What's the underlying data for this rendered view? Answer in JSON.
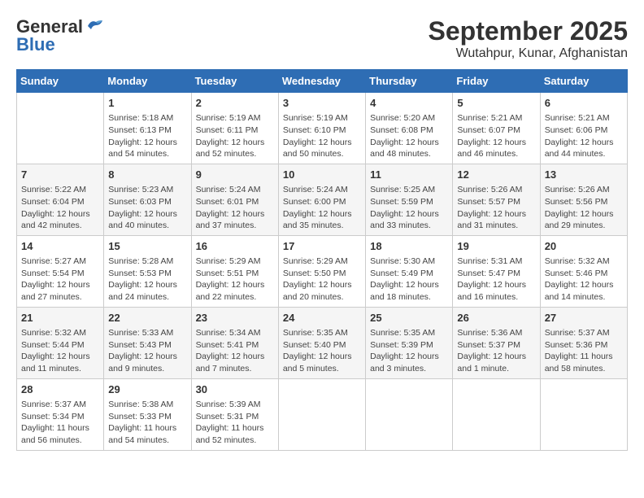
{
  "logo": {
    "line1": "General",
    "line2": "Blue"
  },
  "title": "September 2025",
  "subtitle": "Wutahpur, Kunar, Afghanistan",
  "headers": [
    "Sunday",
    "Monday",
    "Tuesday",
    "Wednesday",
    "Thursday",
    "Friday",
    "Saturday"
  ],
  "weeks": [
    [
      {
        "day": "",
        "content": ""
      },
      {
        "day": "1",
        "content": "Sunrise: 5:18 AM\nSunset: 6:13 PM\nDaylight: 12 hours\nand 54 minutes."
      },
      {
        "day": "2",
        "content": "Sunrise: 5:19 AM\nSunset: 6:11 PM\nDaylight: 12 hours\nand 52 minutes."
      },
      {
        "day": "3",
        "content": "Sunrise: 5:19 AM\nSunset: 6:10 PM\nDaylight: 12 hours\nand 50 minutes."
      },
      {
        "day": "4",
        "content": "Sunrise: 5:20 AM\nSunset: 6:08 PM\nDaylight: 12 hours\nand 48 minutes."
      },
      {
        "day": "5",
        "content": "Sunrise: 5:21 AM\nSunset: 6:07 PM\nDaylight: 12 hours\nand 46 minutes."
      },
      {
        "day": "6",
        "content": "Sunrise: 5:21 AM\nSunset: 6:06 PM\nDaylight: 12 hours\nand 44 minutes."
      }
    ],
    [
      {
        "day": "7",
        "content": "Sunrise: 5:22 AM\nSunset: 6:04 PM\nDaylight: 12 hours\nand 42 minutes."
      },
      {
        "day": "8",
        "content": "Sunrise: 5:23 AM\nSunset: 6:03 PM\nDaylight: 12 hours\nand 40 minutes."
      },
      {
        "day": "9",
        "content": "Sunrise: 5:24 AM\nSunset: 6:01 PM\nDaylight: 12 hours\nand 37 minutes."
      },
      {
        "day": "10",
        "content": "Sunrise: 5:24 AM\nSunset: 6:00 PM\nDaylight: 12 hours\nand 35 minutes."
      },
      {
        "day": "11",
        "content": "Sunrise: 5:25 AM\nSunset: 5:59 PM\nDaylight: 12 hours\nand 33 minutes."
      },
      {
        "day": "12",
        "content": "Sunrise: 5:26 AM\nSunset: 5:57 PM\nDaylight: 12 hours\nand 31 minutes."
      },
      {
        "day": "13",
        "content": "Sunrise: 5:26 AM\nSunset: 5:56 PM\nDaylight: 12 hours\nand 29 minutes."
      }
    ],
    [
      {
        "day": "14",
        "content": "Sunrise: 5:27 AM\nSunset: 5:54 PM\nDaylight: 12 hours\nand 27 minutes."
      },
      {
        "day": "15",
        "content": "Sunrise: 5:28 AM\nSunset: 5:53 PM\nDaylight: 12 hours\nand 24 minutes."
      },
      {
        "day": "16",
        "content": "Sunrise: 5:29 AM\nSunset: 5:51 PM\nDaylight: 12 hours\nand 22 minutes."
      },
      {
        "day": "17",
        "content": "Sunrise: 5:29 AM\nSunset: 5:50 PM\nDaylight: 12 hours\nand 20 minutes."
      },
      {
        "day": "18",
        "content": "Sunrise: 5:30 AM\nSunset: 5:49 PM\nDaylight: 12 hours\nand 18 minutes."
      },
      {
        "day": "19",
        "content": "Sunrise: 5:31 AM\nSunset: 5:47 PM\nDaylight: 12 hours\nand 16 minutes."
      },
      {
        "day": "20",
        "content": "Sunrise: 5:32 AM\nSunset: 5:46 PM\nDaylight: 12 hours\nand 14 minutes."
      }
    ],
    [
      {
        "day": "21",
        "content": "Sunrise: 5:32 AM\nSunset: 5:44 PM\nDaylight: 12 hours\nand 11 minutes."
      },
      {
        "day": "22",
        "content": "Sunrise: 5:33 AM\nSunset: 5:43 PM\nDaylight: 12 hours\nand 9 minutes."
      },
      {
        "day": "23",
        "content": "Sunrise: 5:34 AM\nSunset: 5:41 PM\nDaylight: 12 hours\nand 7 minutes."
      },
      {
        "day": "24",
        "content": "Sunrise: 5:35 AM\nSunset: 5:40 PM\nDaylight: 12 hours\nand 5 minutes."
      },
      {
        "day": "25",
        "content": "Sunrise: 5:35 AM\nSunset: 5:39 PM\nDaylight: 12 hours\nand 3 minutes."
      },
      {
        "day": "26",
        "content": "Sunrise: 5:36 AM\nSunset: 5:37 PM\nDaylight: 12 hours\nand 1 minute."
      },
      {
        "day": "27",
        "content": "Sunrise: 5:37 AM\nSunset: 5:36 PM\nDaylight: 11 hours\nand 58 minutes."
      }
    ],
    [
      {
        "day": "28",
        "content": "Sunrise: 5:37 AM\nSunset: 5:34 PM\nDaylight: 11 hours\nand 56 minutes."
      },
      {
        "day": "29",
        "content": "Sunrise: 5:38 AM\nSunset: 5:33 PM\nDaylight: 11 hours\nand 54 minutes."
      },
      {
        "day": "30",
        "content": "Sunrise: 5:39 AM\nSunset: 5:31 PM\nDaylight: 11 hours\nand 52 minutes."
      },
      {
        "day": "",
        "content": ""
      },
      {
        "day": "",
        "content": ""
      },
      {
        "day": "",
        "content": ""
      },
      {
        "day": "",
        "content": ""
      }
    ]
  ]
}
